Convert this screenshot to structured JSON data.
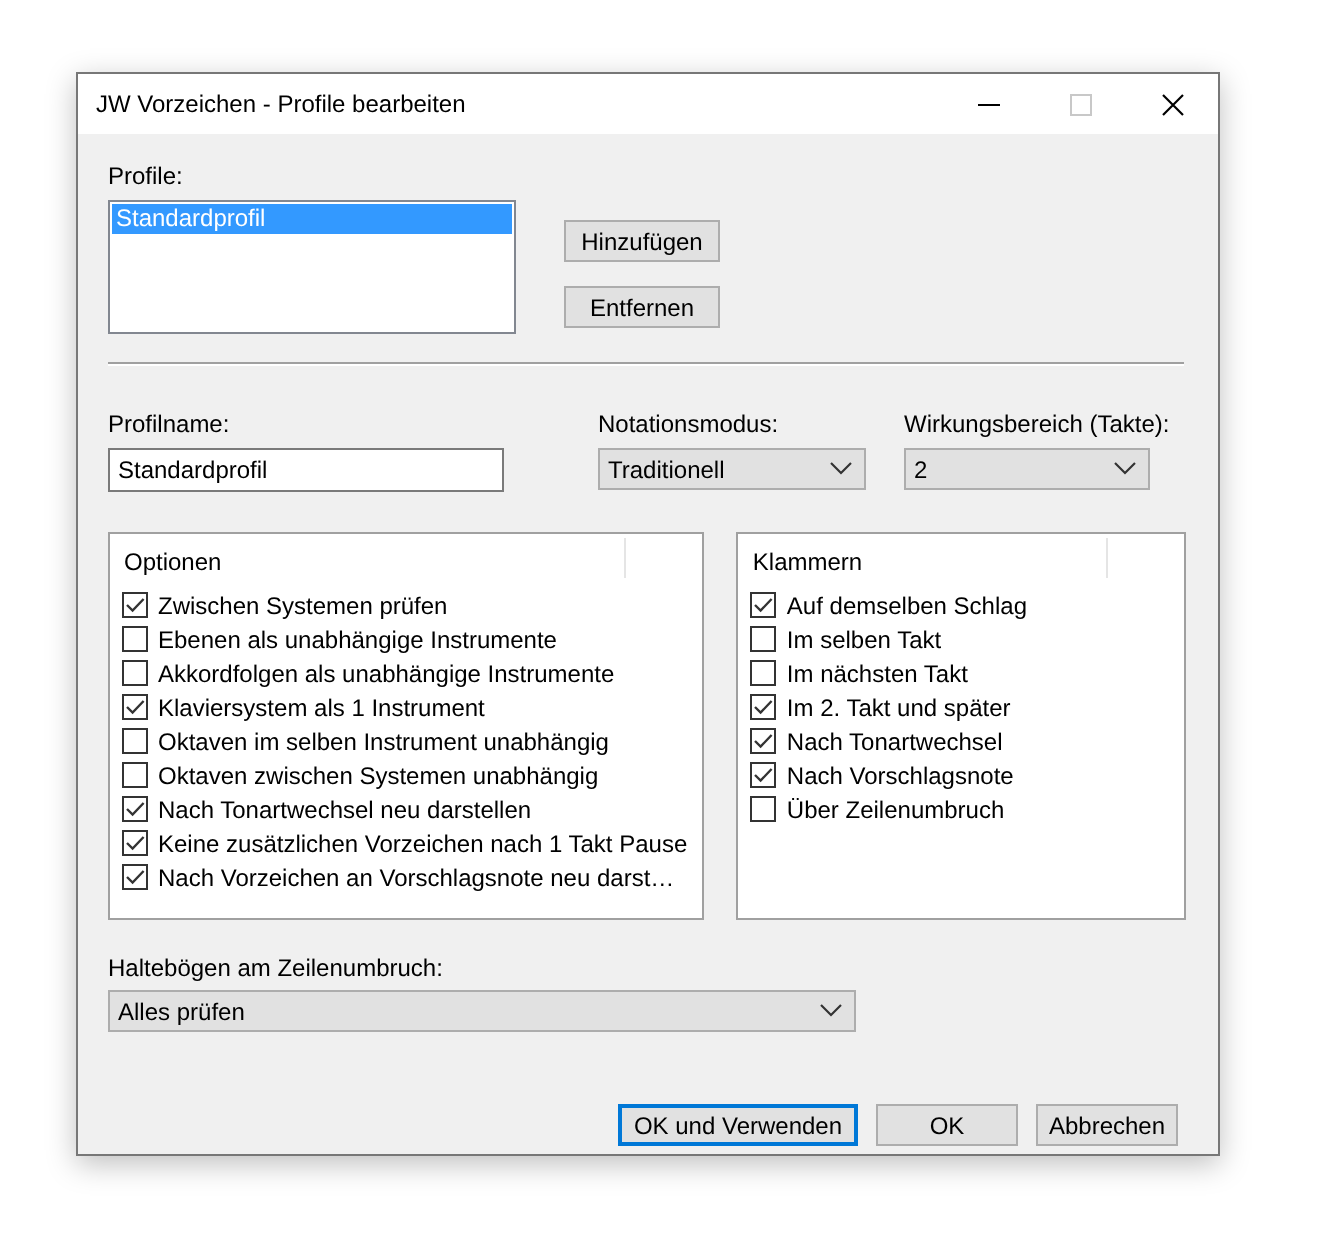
{
  "window": {
    "title": "JW Vorzeichen - Profile bearbeiten"
  },
  "profiles": {
    "label": "Profile:",
    "items": [
      {
        "label": "Standardprofil",
        "selected": true
      }
    ]
  },
  "profile_buttons": [
    "Hinzufügen",
    "Entfernen"
  ],
  "profile_name": {
    "label": "Profilname:",
    "value": "Standardprofil"
  },
  "notation_mode": {
    "label": "Notationsmodus:",
    "value": "Traditionell"
  },
  "scope": {
    "label": "Wirkungsbereich (Takte):",
    "value": "2"
  },
  "options": {
    "title": "Optionen",
    "items": [
      {
        "label": "Zwischen Systemen prüfen",
        "checked": true
      },
      {
        "label": "Ebenen als unabhängige Instrumente",
        "checked": false
      },
      {
        "label": "Akkordfolgen als unabhängige Instrumente",
        "checked": false
      },
      {
        "label": "Klaviersystem als 1 Instrument",
        "checked": true
      },
      {
        "label": "Oktaven im selben Instrument unabhängig",
        "checked": false
      },
      {
        "label": "Oktaven zwischen Systemen unabhängig",
        "checked": false
      },
      {
        "label": "Nach Tonartwechsel neu darstellen",
        "checked": true
      },
      {
        "label": "Keine zusätzlichen Vorzeichen nach 1 Takt Pause",
        "checked": true
      },
      {
        "label": "Nach Vorzeichen an Vorschlagsnote neu darst…",
        "checked": true
      }
    ]
  },
  "brackets": {
    "title": "Klammern",
    "items": [
      {
        "label": "Auf demselben Schlag",
        "checked": true
      },
      {
        "label": "Im selben Takt",
        "checked": false
      },
      {
        "label": "Im nächsten Takt",
        "checked": false
      },
      {
        "label": "Im 2. Takt und später",
        "checked": true
      },
      {
        "label": "Nach Tonartwechsel",
        "checked": true
      },
      {
        "label": "Nach Vorschlagsnote",
        "checked": true
      },
      {
        "label": "Über Zeilenumbruch",
        "checked": false
      }
    ]
  },
  "ties": {
    "label": "Haltebögen am Zeilenumbruch:",
    "value": "Alles prüfen"
  },
  "buttons": [
    {
      "label": "OK und Verwenden",
      "default": true
    },
    {
      "label": "OK",
      "default": false
    },
    {
      "label": "Abbrechen",
      "default": false
    }
  ]
}
